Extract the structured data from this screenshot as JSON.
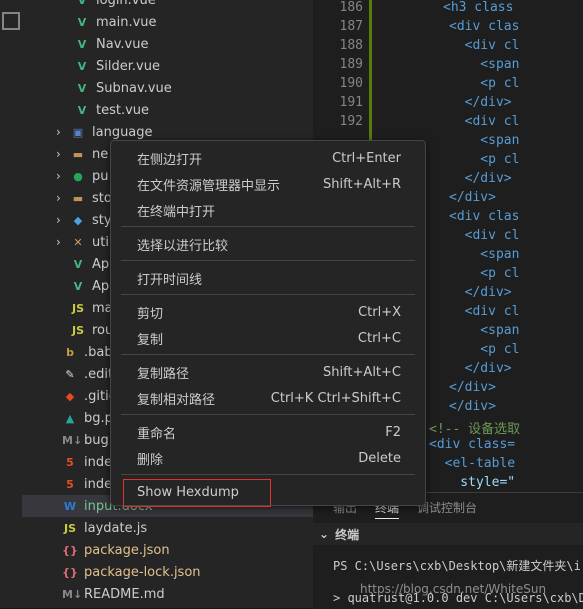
{
  "explorer": {
    "items": [
      {
        "label": "login.vue",
        "icon": "V",
        "icon_name": "vue-file-icon",
        "color": "#41b883",
        "badge": ""
      },
      {
        "label": "main.vue",
        "icon": "V",
        "icon_name": "vue-file-icon",
        "color": "#41b883",
        "badge": ""
      },
      {
        "label": "Nav.vue",
        "icon": "V",
        "icon_name": "vue-file-icon",
        "color": "#41b883",
        "badge": ""
      },
      {
        "label": "Silder.vue",
        "icon": "V",
        "icon_name": "vue-file-icon",
        "color": "#41b883",
        "badge": ""
      },
      {
        "label": "Subnav.vue",
        "icon": "V",
        "icon_name": "vue-file-icon",
        "color": "#41b883",
        "badge": ""
      },
      {
        "label": "test.vue",
        "icon": "V",
        "icon_name": "vue-file-icon",
        "color": "#41b883",
        "badge": ""
      },
      {
        "label": "language",
        "icon": "▣",
        "icon_name": "folder-icon",
        "color": "#5a82c6",
        "badge": "",
        "chevron": "›"
      },
      {
        "label": "ne",
        "icon": "▬",
        "icon_name": "folder-icon",
        "color": "#c09553",
        "badge": "",
        "chevron": "›"
      },
      {
        "label": "pu",
        "icon": "●",
        "icon_name": "folder-icon",
        "color": "#23a55a",
        "badge": "",
        "chevron": "›"
      },
      {
        "label": "sto",
        "icon": "▬",
        "icon_name": "folder-icon",
        "color": "#c09553",
        "badge": "",
        "chevron": "›"
      },
      {
        "label": "sty",
        "icon": "◆",
        "icon_name": "folder-icon",
        "color": "#4aa3df",
        "badge": "",
        "chevron": "›"
      },
      {
        "label": "uti",
        "icon": "✕",
        "icon_name": "tools-folder-icon",
        "color": "#d19a66",
        "badge": "",
        "chevron": "›"
      },
      {
        "label": "Ap",
        "icon": "V",
        "icon_name": "vue-file-icon",
        "color": "#41b883",
        "badge": ""
      },
      {
        "label": "Ap",
        "icon": "V",
        "icon_name": "vue-file-icon",
        "color": "#41b883",
        "badge": ""
      },
      {
        "label": "ma",
        "icon": "JS",
        "icon_name": "js-file-icon",
        "color": "#cbcb41",
        "badge": ""
      },
      {
        "label": "rou",
        "icon": "JS",
        "icon_name": "js-file-icon",
        "color": "#cbcb41",
        "badge": ""
      },
      {
        "label": ".bab",
        "icon": "b",
        "icon_name": "babel-file-icon",
        "color": "#c0a040",
        "badge": ""
      },
      {
        "label": ".edit",
        "icon": "✎",
        "icon_name": "editorconfig-icon",
        "color": "#dddddd",
        "badge": ""
      },
      {
        "label": ".gitig",
        "icon": "◆",
        "icon_name": "git-icon",
        "color": "#e64a19",
        "badge": ""
      },
      {
        "label": "bg.p",
        "icon": "▲",
        "icon_name": "image-file-icon",
        "color": "#26a69a",
        "badge": ""
      },
      {
        "label": "bug",
        "icon": "M↓",
        "icon_name": "markdown-file-icon",
        "color": "#888888",
        "badge": ""
      },
      {
        "label": "inde",
        "icon": "5",
        "icon_name": "html-file-icon",
        "color": "#e44d26",
        "badge": ""
      },
      {
        "label": "inde",
        "icon": "5",
        "icon_name": "html-file-icon",
        "color": "#e44d26",
        "badge": ""
      },
      {
        "label": "input.docx",
        "icon": "W",
        "icon_name": "word-file-icon",
        "color": "#2b7cd3",
        "badge": "U"
      },
      {
        "label": "laydate.js",
        "icon": "JS",
        "icon_name": "js-file-icon",
        "color": "#cbcb41",
        "badge": ""
      },
      {
        "label": "package.json",
        "icon": "{}",
        "icon_name": "json-file-icon",
        "color": "#e06c75",
        "badge": "M"
      },
      {
        "label": "package-lock.json",
        "icon": "{}",
        "icon_name": "json-file-icon",
        "color": "#e06c75",
        "badge": "M"
      },
      {
        "label": "README.md",
        "icon": "M↓",
        "icon_name": "markdown-file-icon",
        "color": "#888888",
        "badge": ""
      }
    ]
  },
  "editor": {
    "line_numbers": [
      "186",
      "187",
      "188",
      "189",
      "190",
      "191",
      "192"
    ],
    "lines": [
      [
        {
          "t": "<h3 class",
          "c": "tag"
        }
      ],
      [
        {
          "t": "<div clas",
          "c": "tag"
        }
      ],
      [
        {
          "t": "  <div cl",
          "c": "tag"
        }
      ],
      [
        {
          "t": "    <span",
          "c": "tag"
        }
      ],
      [
        {
          "t": "    <p cl",
          "c": "tag"
        }
      ],
      [
        {
          "t": "  </div>",
          "c": "tag"
        }
      ],
      [
        {
          "t": "  <div cl",
          "c": "tag"
        }
      ],
      [
        {
          "t": "    <span",
          "c": "tag"
        }
      ],
      [
        {
          "t": "    <p cl",
          "c": "tag"
        }
      ],
      [
        {
          "t": "  </div>",
          "c": "tag"
        }
      ],
      [
        {
          "t": "</div>",
          "c": "tag"
        }
      ],
      [
        {
          "t": "<div clas",
          "c": "tag"
        }
      ],
      [
        {
          "t": "  <div cl",
          "c": "tag"
        }
      ],
      [
        {
          "t": "    <span",
          "c": "tag"
        }
      ],
      [
        {
          "t": "    <p cl",
          "c": "tag"
        }
      ],
      [
        {
          "t": "  </div>",
          "c": "tag"
        }
      ],
      [
        {
          "t": "  <div cl",
          "c": "tag"
        }
      ],
      [
        {
          "t": "    <span",
          "c": "tag"
        }
      ],
      [
        {
          "t": "    <p cl",
          "c": "tag"
        }
      ],
      [
        {
          "t": "  </div>",
          "c": "tag"
        }
      ],
      [
        {
          "t": "</div>",
          "c": "tag"
        }
      ],
      [
        {
          "t": "</div>",
          "c": "tag"
        }
      ],
      [
        {
          "t": "<!-- 设备选取",
          "c": "cmt"
        }
      ],
      [
        {
          "t": "<div class=",
          "c": "tag"
        }
      ],
      [
        {
          "t": "  <el-table",
          "c": "tag"
        }
      ],
      [
        {
          "t": "    style=\"",
          "c": "attr"
        }
      ]
    ]
  },
  "panel": {
    "tabs": [
      "输出",
      "终端",
      "调试控制台"
    ],
    "active_tab": "终端",
    "terminal_title": "终端",
    "terminal_lines": [
      "PS C:\\Users\\cxb\\Desktop\\新建文件夹\\i",
      "> quatrust@1.0.0 dev C:\\Users\\cxb\\De"
    ]
  },
  "watermark": "https://blog.csdn.net/WhiteSun",
  "context_menu": {
    "groups": [
      [
        {
          "label": "在侧边打开",
          "shortcut": "Ctrl+Enter"
        },
        {
          "label": "在文件资源管理器中显示",
          "shortcut": "Shift+Alt+R"
        },
        {
          "label": "在终端中打开",
          "shortcut": ""
        }
      ],
      [
        {
          "label": "选择以进行比较",
          "shortcut": ""
        }
      ],
      [
        {
          "label": "打开时间线",
          "shortcut": ""
        }
      ],
      [
        {
          "label": "剪切",
          "shortcut": "Ctrl+X"
        },
        {
          "label": "复制",
          "shortcut": "Ctrl+C"
        }
      ],
      [
        {
          "label": "复制路径",
          "shortcut": "Shift+Alt+C"
        },
        {
          "label": "复制相对路径",
          "shortcut": "Ctrl+K Ctrl+Shift+C"
        }
      ],
      [
        {
          "label": "重命名",
          "shortcut": "F2"
        },
        {
          "label": "删除",
          "shortcut": "Delete"
        }
      ],
      [
        {
          "label": "Show Hexdump",
          "shortcut": "",
          "highlighted": true
        }
      ]
    ]
  },
  "colors": {
    "highlight_border": "#e0312f",
    "modified": "#e2c08d",
    "diff_bar": "#587c0c"
  }
}
